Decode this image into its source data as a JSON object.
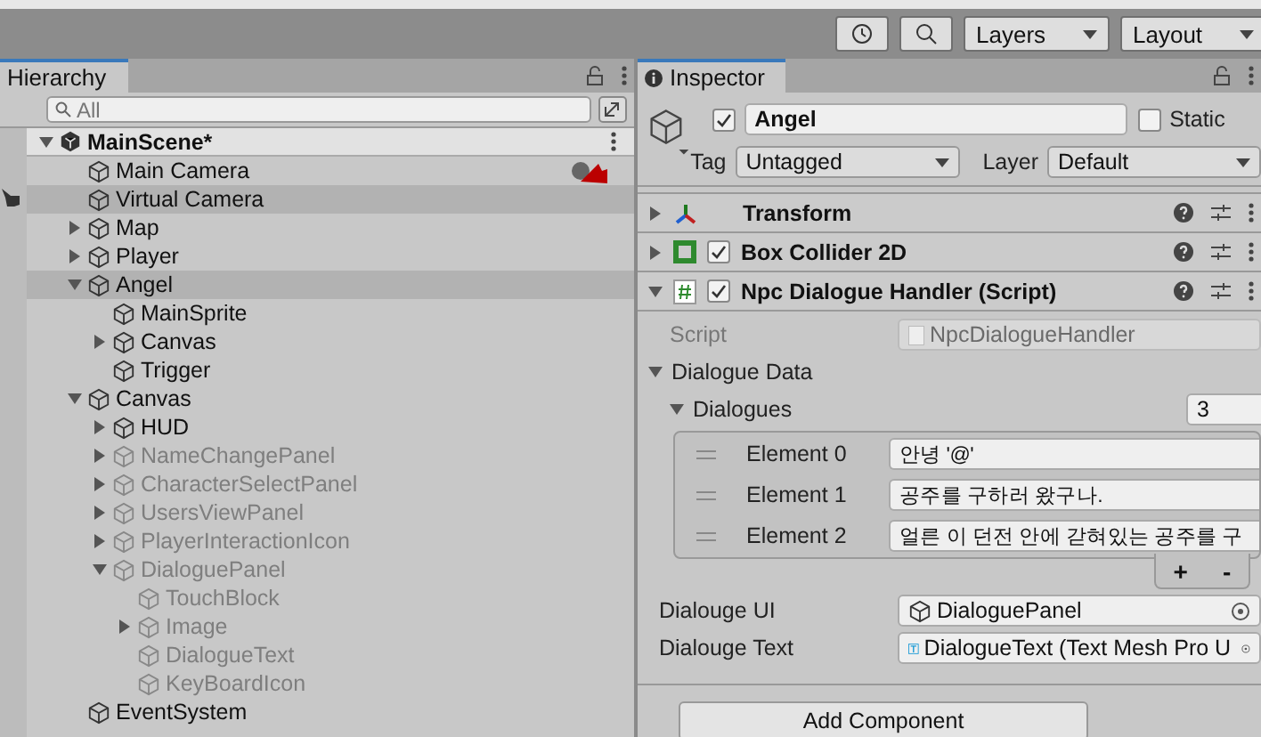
{
  "toolbar": {
    "layers": "Layers",
    "layout": "Layout"
  },
  "hierarchy": {
    "title": "Hierarchy",
    "search": {
      "placeholder": "All"
    },
    "scene": {
      "name": "MainScene*",
      "expanded": true,
      "children": [
        {
          "name": "Main Camera",
          "selected": false,
          "disabled": false,
          "gizmo": true
        },
        {
          "name": "Virtual Camera",
          "selected": true,
          "disabled": false,
          "hand": true
        },
        {
          "name": "Map",
          "selected": false,
          "disabled": false,
          "expanded": false
        },
        {
          "name": "Player",
          "selected": false,
          "disabled": false,
          "expanded": false
        },
        {
          "name": "Angel",
          "selected": true,
          "disabled": false,
          "expanded": true,
          "children": [
            {
              "name": "MainSprite",
              "selected": false,
              "disabled": false
            },
            {
              "name": "Canvas",
              "selected": false,
              "disabled": false,
              "expanded": false
            },
            {
              "name": "Trigger",
              "selected": false,
              "disabled": false
            }
          ]
        },
        {
          "name": "Canvas",
          "selected": false,
          "disabled": false,
          "expanded": true,
          "children": [
            {
              "name": "HUD",
              "selected": false,
              "disabled": false,
              "expanded": false
            },
            {
              "name": "NameChangePanel",
              "selected": false,
              "disabled": true,
              "expanded": false
            },
            {
              "name": "CharacterSelectPanel",
              "selected": false,
              "disabled": true,
              "expanded": false
            },
            {
              "name": "UsersViewPanel",
              "selected": false,
              "disabled": true,
              "expanded": false
            },
            {
              "name": "PlayerInteractionIcon",
              "selected": false,
              "disabled": true,
              "expanded": false
            },
            {
              "name": "DialoguePanel",
              "selected": false,
              "disabled": true,
              "expanded": true,
              "children": [
                {
                  "name": "TouchBlock",
                  "selected": false,
                  "disabled": true
                },
                {
                  "name": "Image",
                  "selected": false,
                  "disabled": true,
                  "expanded": false
                },
                {
                  "name": "DialogueText",
                  "selected": false,
                  "disabled": true
                },
                {
                  "name": "KeyBoardIcon",
                  "selected": false,
                  "disabled": true
                }
              ]
            }
          ]
        },
        {
          "name": "EventSystem",
          "selected": false,
          "disabled": false
        }
      ]
    }
  },
  "inspector": {
    "title": "Inspector",
    "object": {
      "active": true,
      "name": "Angel",
      "static": false,
      "static_label": "Static",
      "tag_label": "Tag",
      "tag": "Untagged",
      "layer_label": "Layer",
      "layer": "Default"
    },
    "components": [
      {
        "kind": "transform",
        "name": "Transform",
        "expanded": false
      },
      {
        "kind": "collider",
        "name": "Box Collider 2D",
        "expanded": false,
        "enabled": true
      },
      {
        "kind": "script",
        "name": "Npc Dialogue Handler (Script)",
        "expanded": true,
        "enabled": true
      }
    ],
    "script": {
      "label": "Script",
      "value": "NpcDialogueHandler"
    },
    "data": {
      "label": "Dialogue Data",
      "expanded": true,
      "list_label": "Dialogues",
      "list_expanded": true,
      "count": "3",
      "elements": [
        {
          "label": "Element 0",
          "value": "안녕  '@'"
        },
        {
          "label": "Element 1",
          "value": "공주를 구하러 왔구나."
        },
        {
          "label": "Element 2",
          "value": "얼른 이 던전 안에 갇혀있는 공주를 구"
        }
      ],
      "add": "+",
      "remove": "-"
    },
    "refs": [
      {
        "kind": "object",
        "label": "Dialouge UI",
        "value": "DialoguePanel"
      },
      {
        "kind": "text",
        "label": "Dialouge Text",
        "value": "DialogueText (Text Mesh Pro U"
      }
    ],
    "add_component": "Add Component"
  }
}
